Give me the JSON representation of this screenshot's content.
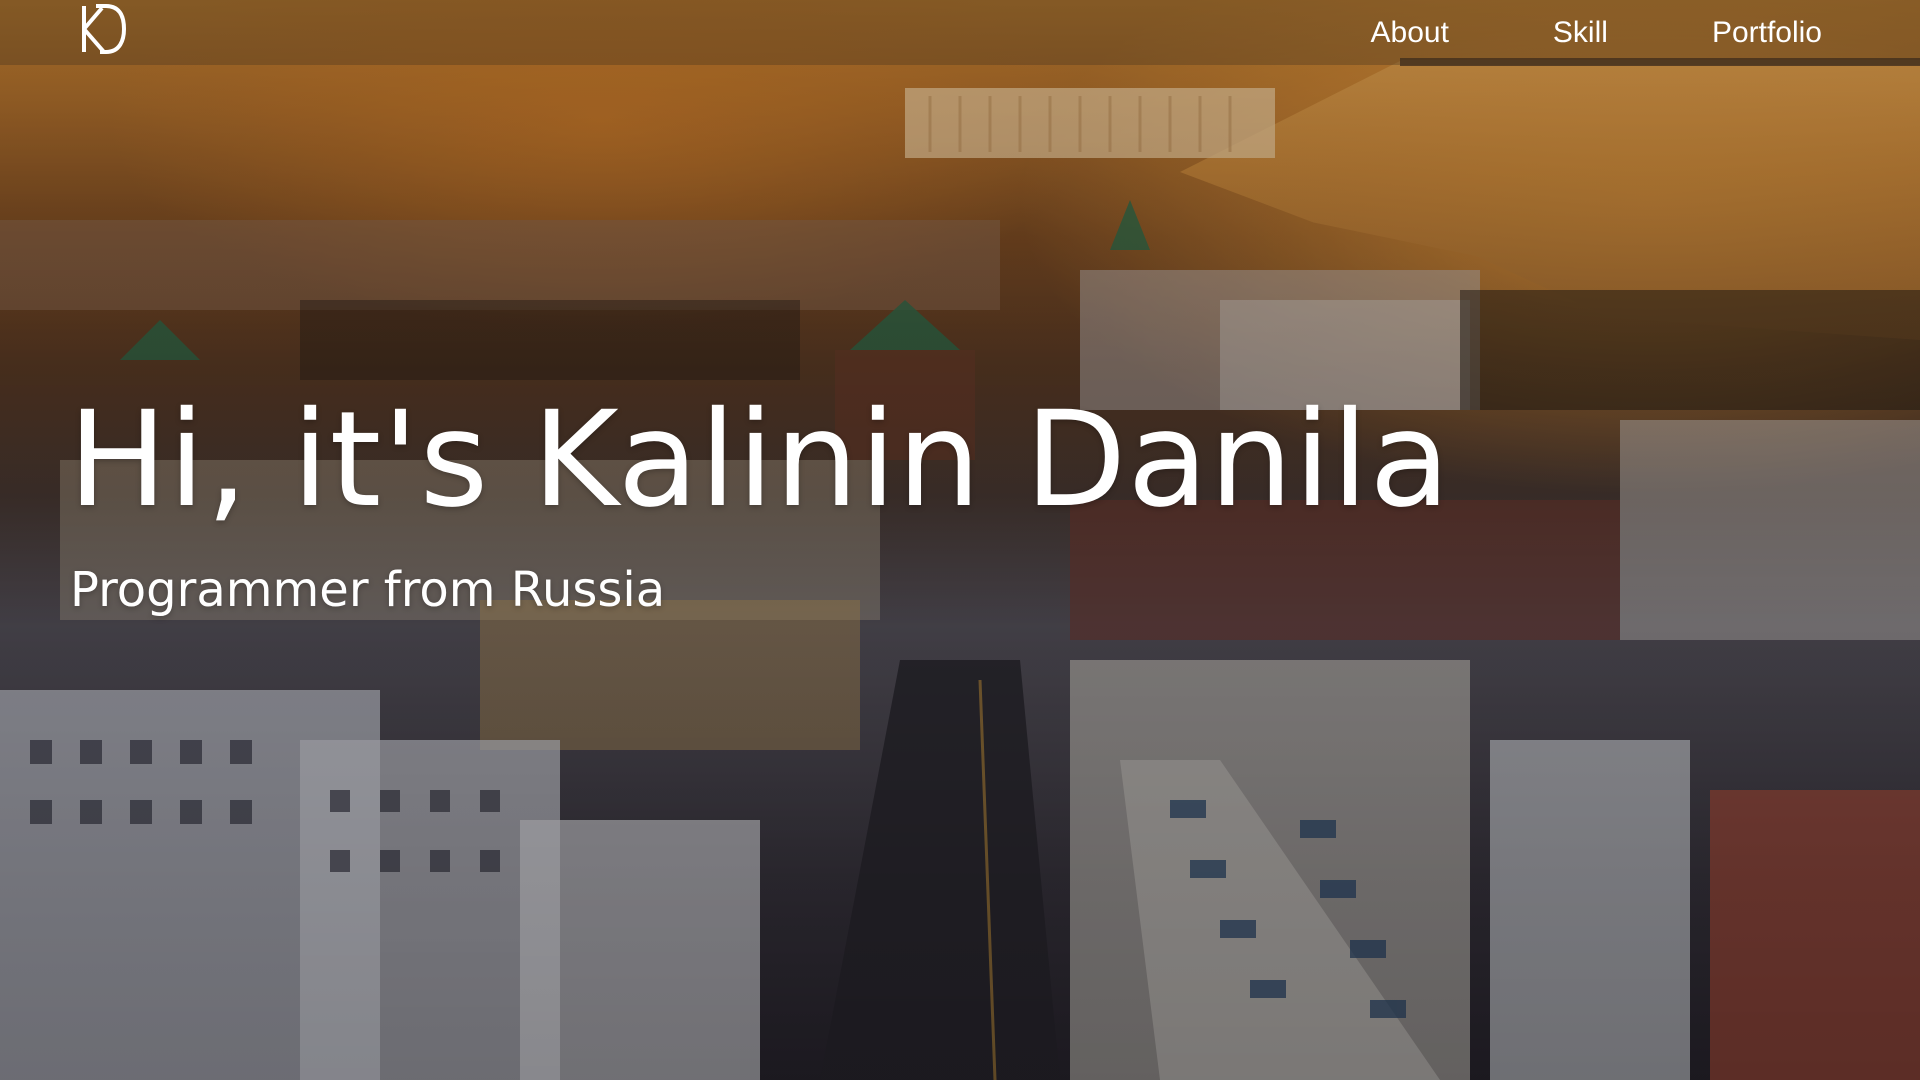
{
  "brand": {
    "logo_letters": "KD"
  },
  "nav": {
    "items": [
      {
        "label": "About"
      },
      {
        "label": "Skill"
      },
      {
        "label": "Portfolio"
      }
    ]
  },
  "hero": {
    "title": "Hi, it's Kalinin Danila",
    "subtitle": "Programmer from Russia",
    "background": "aerial-city-sunset-photo"
  },
  "colors": {
    "text": "#ffffff",
    "sky_warm": "#c4812f",
    "river": "#d89a4a"
  }
}
